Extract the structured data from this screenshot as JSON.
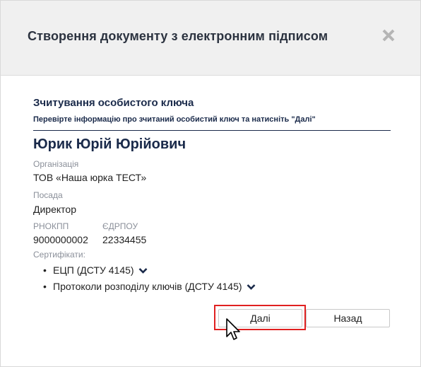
{
  "dialog": {
    "title": "Створення документу з електронним підписом",
    "close_icon": "close-icon"
  },
  "section": {
    "title": "Зчитування особистого ключа",
    "subtitle": "Перевірте інформацію про зчитаний особистий ключ та натисніть \"Далі\""
  },
  "person": {
    "name": "Юрик Юрій Юрійович",
    "organization_label": "Організація",
    "organization_value": "ТОВ «Наша юрка ТЕСТ»",
    "position_label": "Посада",
    "position_value": "Директор",
    "rnokpp_label": "РНОКПП",
    "rnokpp_value": "9000000002",
    "edrpou_label": "ЄДРПОУ",
    "edrpou_value": "22334455",
    "certificates_label": "Сертифікати:",
    "certificates": [
      {
        "label": "ЕЦП (ДСТУ 4145)"
      },
      {
        "label": "Протоколи розподілу ключів (ДСТУ 4145)"
      }
    ]
  },
  "buttons": {
    "next_label": "Далі",
    "back_label": "Назад"
  },
  "colors": {
    "header_bg": "#f0f0f0",
    "title_text": "#2c3340",
    "accent_text": "#1a2a4a",
    "highlight": "#e02020"
  }
}
